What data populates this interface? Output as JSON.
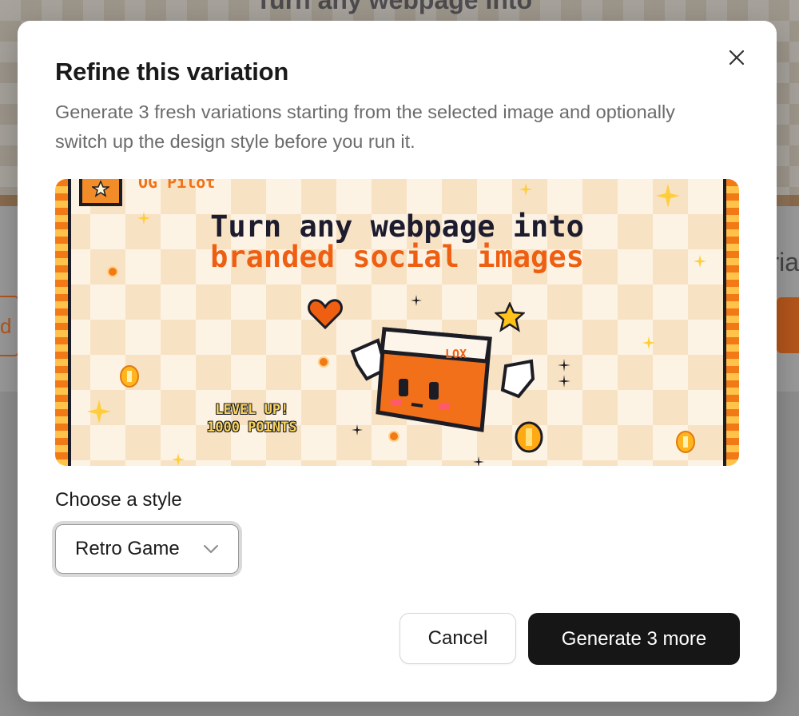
{
  "background": {
    "ghost_title": "Turn any webpage into",
    "edge_text": "ria",
    "edge_letter": "d"
  },
  "modal": {
    "title": "Refine this variation",
    "description": "Generate 3 fresh variations starting from the selected image and optionally switch up the design style before you run it.",
    "close_icon": "close-icon"
  },
  "preview": {
    "brand": "OG Pilot",
    "headline_line1": "Turn any webpage into",
    "headline_line2": "branded social images",
    "level_up_line1": "LEVEL UP!",
    "level_up_line2": "1000 POINTS",
    "mascot_tag": "LOX",
    "colors": {
      "orange": "#ee5f12",
      "dark": "#1c1c2e",
      "cream": "#fdf3e4"
    }
  },
  "style": {
    "label": "Choose a style",
    "selected": "Retro Game",
    "icon": "chevron-down-icon"
  },
  "footer": {
    "cancel_label": "Cancel",
    "generate_label": "Generate 3 more"
  }
}
